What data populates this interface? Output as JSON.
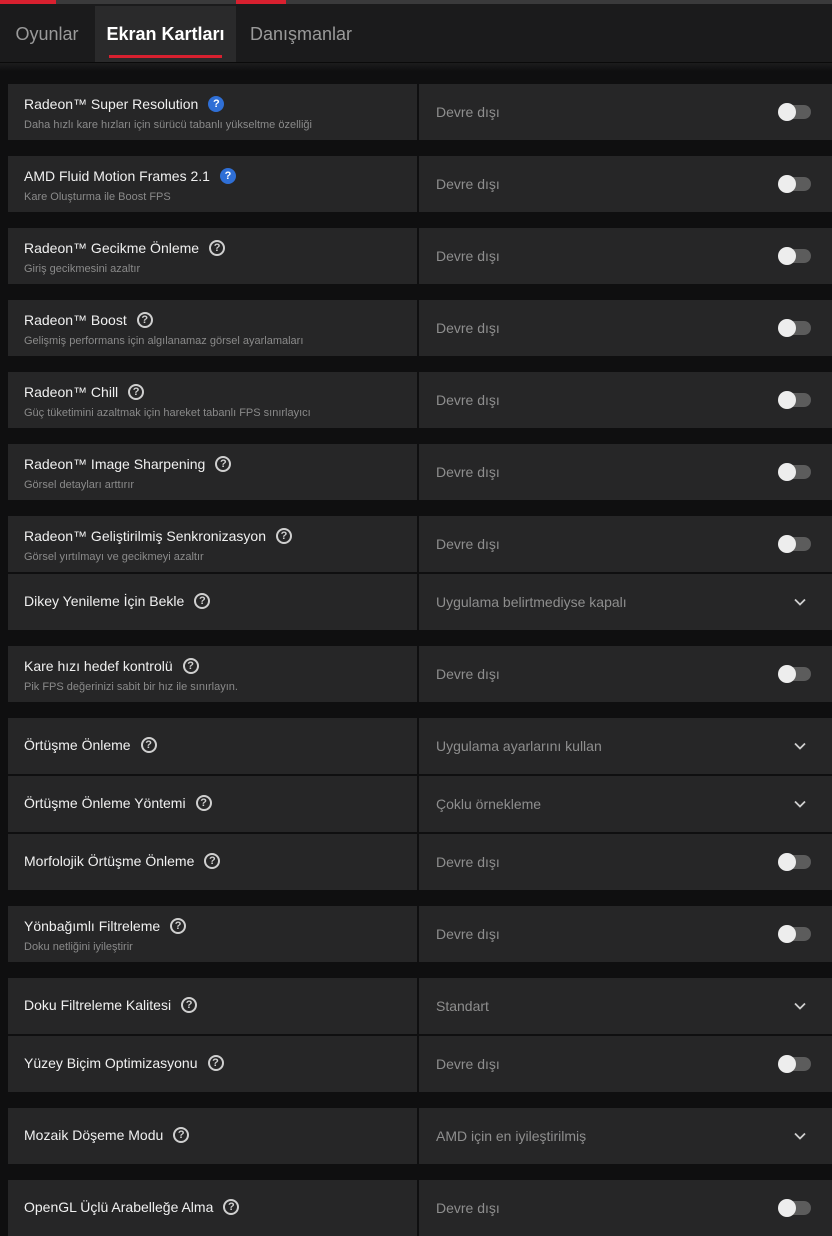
{
  "tabs": [
    {
      "label": "Oyunlar",
      "active": false
    },
    {
      "label": "Ekran Kartları",
      "active": true
    },
    {
      "label": "Danışmanlar",
      "active": false
    }
  ],
  "accent_color": "#d8202f",
  "settings": [
    {
      "title": "Radeon™ Super Resolution",
      "help_icon": "info-blue",
      "subtitle": "Daha hızlı kare hızları için sürücü tabanlı yükseltme özelliği",
      "value": "Devre dışı",
      "control": "toggle",
      "on": false
    },
    {
      "title": "AMD Fluid Motion Frames 2.1",
      "help_icon": "info-blue",
      "subtitle": "Kare Oluşturma ile Boost FPS",
      "value": "Devre dışı",
      "control": "toggle",
      "on": false
    },
    {
      "title": "Radeon™ Gecikme Önleme",
      "help_icon": "help",
      "subtitle": "Giriş gecikmesini azaltır",
      "value": "Devre dışı",
      "control": "toggle",
      "on": false
    },
    {
      "title": "Radeon™ Boost",
      "help_icon": "help",
      "subtitle": "Gelişmiş performans için algılanamaz görsel ayarlamaları",
      "value": "Devre dışı",
      "control": "toggle",
      "on": false
    },
    {
      "title": "Radeon™ Chill",
      "help_icon": "help",
      "subtitle": "Güç tüketimini azaltmak için hareket tabanlı FPS sınırlayıcı",
      "value": "Devre dışı",
      "control": "toggle",
      "on": false
    },
    {
      "title": "Radeon™ Image Sharpening",
      "help_icon": "help",
      "subtitle": "Görsel detayları arttırır",
      "value": "Devre dışı",
      "control": "toggle",
      "on": false
    },
    {
      "title": "Radeon™ Geliştirilmiş Senkronizasyon",
      "help_icon": "help",
      "subtitle": "Görsel yırtılmayı ve gecikmeyi azaltır",
      "value": "Devre dışı",
      "control": "toggle",
      "on": false
    },
    {
      "title": "Dikey Yenileme İçin Bekle",
      "help_icon": "help",
      "subtitle": "",
      "value": "Uygulama belirtmediyse kapalı",
      "control": "dropdown"
    },
    {
      "title": "Kare hızı hedef kontrolü",
      "help_icon": "help",
      "subtitle": "Pik FPS değerinizi sabit bir hız ile sınırlayın.",
      "value": "Devre dışı",
      "control": "toggle",
      "on": false
    },
    {
      "title": "Örtüşme Önleme",
      "help_icon": "help",
      "subtitle": "",
      "value": "Uygulama ayarlarını kullan",
      "control": "dropdown"
    },
    {
      "title": "Örtüşme Önleme Yöntemi",
      "help_icon": "help",
      "subtitle": "",
      "value": "Çoklu örnekleme",
      "control": "dropdown"
    },
    {
      "title": "Morfolojik Örtüşme Önleme",
      "help_icon": "help",
      "subtitle": "",
      "value": "Devre dışı",
      "control": "toggle",
      "on": false
    },
    {
      "title": "Yönbağımlı Filtreleme",
      "help_icon": "help",
      "subtitle": "Doku netliğini iyileştirir",
      "value": "Devre dışı",
      "control": "toggle",
      "on": false
    },
    {
      "title": "Doku Filtreleme Kalitesi",
      "help_icon": "help",
      "subtitle": "",
      "value": "Standart",
      "control": "dropdown"
    },
    {
      "title": "Yüzey Biçim Optimizasyonu",
      "help_icon": "help",
      "subtitle": "",
      "value": "Devre dışı",
      "control": "toggle",
      "on": false
    },
    {
      "title": "Mozaik Döşeme Modu",
      "help_icon": "help",
      "subtitle": "",
      "value": "AMD için en iyileştirilmiş",
      "control": "dropdown"
    },
    {
      "title": "OpenGL Üçlü Arabelleğe Alma",
      "help_icon": "help",
      "subtitle": "",
      "value": "Devre dışı",
      "control": "toggle",
      "on": false
    }
  ]
}
